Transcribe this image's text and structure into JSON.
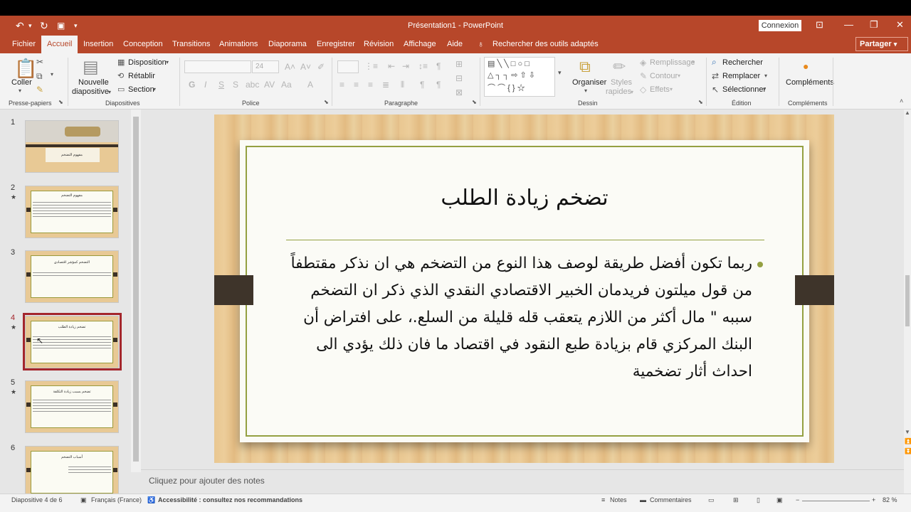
{
  "window": {
    "title": "Présentation1  -  PowerPoint",
    "connexion": "Connexion"
  },
  "tabs": [
    "Fichier",
    "Accueil",
    "Insertion",
    "Conception",
    "Transitions",
    "Animations",
    "Diaporama",
    "Enregistrer",
    "Révision",
    "Affichage",
    "Aide"
  ],
  "active_tab": "Accueil",
  "search_tools": "Rechercher des outils adaptés",
  "share": "Partager",
  "ribbon": {
    "presse": {
      "coller": "Coller",
      "label": "Presse-papiers"
    },
    "diapositives": {
      "nouvelle1": "Nouvelle",
      "nouvelle2": "diapositive",
      "disposition": "Disposition",
      "retablir": "Rétablir",
      "section": "Section",
      "label": "Diapositives"
    },
    "police": {
      "size": "24",
      "label": "Police",
      "buttons": [
        "G",
        "I",
        "S",
        "S",
        "AV",
        "Aa"
      ]
    },
    "paragraphe": {
      "label": "Paragraphe"
    },
    "dessin": {
      "organiser": "Organiser",
      "styles1": "Styles",
      "styles2": "rapides",
      "remplissage": "Remplissage",
      "contour": "Contour",
      "effets": "Effets",
      "label": "Dessin"
    },
    "edition": {
      "rechercher": "Rechercher",
      "remplacer": "Remplacer",
      "selectionner": "Sélectionner",
      "label": "Édition"
    },
    "complements": {
      "btn": "Compléments",
      "label": "Compléments"
    }
  },
  "thumbnails": [
    {
      "num": "1",
      "title": "مفهوم التضخم"
    },
    {
      "num": "2",
      "title": "مفهوم التضخم"
    },
    {
      "num": "3",
      "title": "التضخم كمؤشر اقتصادي"
    },
    {
      "num": "4",
      "title": "تضخم زيادة الطلب"
    },
    {
      "num": "5",
      "title": "تضخم بسبب زيادة التكلفة"
    },
    {
      "num": "6",
      "title": "أسباب التضخم"
    }
  ],
  "slide": {
    "title": "تضخم زيادة الطلب",
    "body": "ربما تكون أفضل طريقة لوصف هذا النوع من التضخم هي ان نذكر مقتطفاً من قول ميلتون فريدمان الخبير الاقتصادي النقدي الذي ذكر ان التضخم سببه \" مال أكثر من اللازم يتعقب قله قليلة من السلع.، على افتراض أن البنك المركزي قام بزيادة طبع النقود في اقتصاد ما فان ذلك يؤدي الى احداث أثار تضخمية"
  },
  "notes_placeholder": "Cliquez pour ajouter des notes",
  "status": {
    "slide": "Diapositive 4 de 6",
    "lang": "Français (France)",
    "access": "Accessibilité : consultez nos recommandations",
    "notes": "Notes",
    "comments": "Commentaires",
    "zoom": "82 %"
  },
  "colors": {
    "accent": "#b7472a",
    "frame": "#94a042",
    "selected": "#a4262c"
  }
}
